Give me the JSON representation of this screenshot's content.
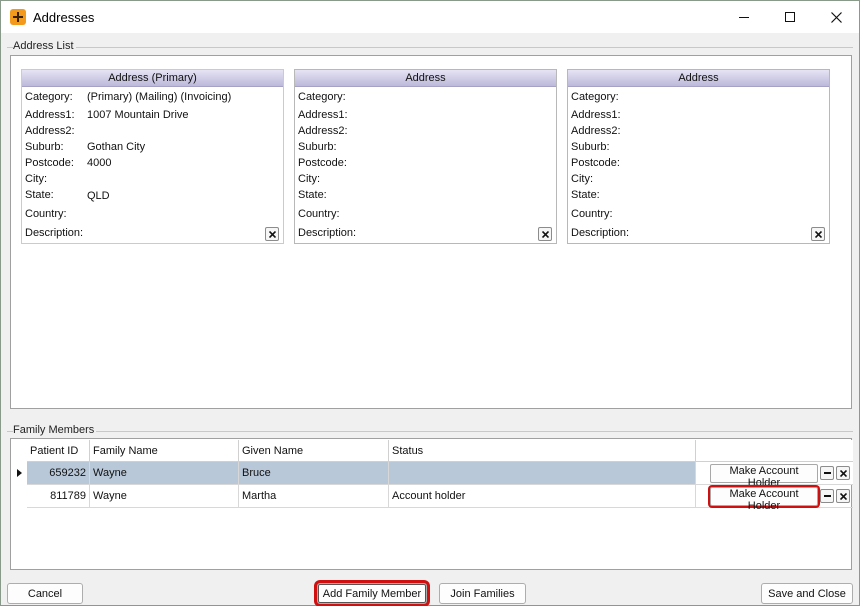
{
  "window": {
    "title": "Addresses"
  },
  "address_list": {
    "group_label": "Address List",
    "field_labels": {
      "category": "Category:",
      "address1": "Address1:",
      "address2": "Address2:",
      "suburb": "Suburb:",
      "postcode": "Postcode:",
      "city": "City:",
      "state": "State:",
      "country": "Country:",
      "description": "Description:"
    },
    "cards": [
      {
        "header": "Address (Primary)",
        "category": "(Primary) (Mailing) (Invoicing)",
        "address1": "1007 Mountain Drive",
        "address2": "",
        "suburb": "Gothan City",
        "postcode": "4000",
        "city": "",
        "state": "QLD",
        "country": "",
        "description": ""
      },
      {
        "header": "Address",
        "category": "",
        "address1": "",
        "address2": "",
        "suburb": "",
        "postcode": "",
        "city": "",
        "state": "",
        "country": "",
        "description": ""
      },
      {
        "header": "Address",
        "category": "",
        "address1": "",
        "address2": "",
        "suburb": "",
        "postcode": "",
        "city": "",
        "state": "",
        "country": "",
        "description": ""
      }
    ]
  },
  "family_members": {
    "group_label": "Family Members",
    "columns": [
      "Patient ID",
      "Family Name",
      "Given Name",
      "Status"
    ],
    "rows": [
      {
        "patient_id": "659232",
        "family_name": "Wayne",
        "given_name": "Bruce",
        "status": "",
        "action_label": "Make Account Holder",
        "selected": true
      },
      {
        "patient_id": "811789",
        "family_name": "Wayne",
        "given_name": "Martha",
        "status": "Account holder",
        "action_label": "Make Account Holder",
        "selected": false
      }
    ]
  },
  "buttons": {
    "cancel": "Cancel",
    "add_family_member": "Add Family Member",
    "join_families": "Join Families",
    "save_and_close": "Save and Close"
  },
  "colors": {
    "selected_row": "#b9c8d8",
    "highlight": "#d01010",
    "card_header": "#bcb8d9",
    "app_icon": "#f39a1d"
  }
}
